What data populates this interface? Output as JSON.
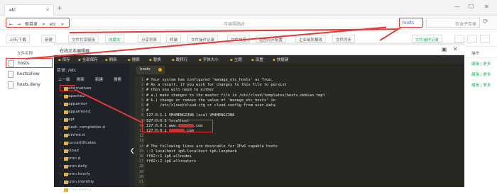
{
  "tab": {
    "title": "etc"
  },
  "window": {
    "minimize": "—",
    "maximize": "☐",
    "close": "✕"
  },
  "addressbar": {
    "back": "←",
    "forward": "→",
    "crumbs": [
      "根目录",
      ">",
      "etc",
      ">"
    ],
    "url": "",
    "url_hint": "可编辑路径",
    "search_value": "hosts",
    "search_placeholder": "包含子目录",
    "refresh": "⟳"
  },
  "toolbar": {
    "buttons": [
      "上传/下载",
      "新建",
      "文件共享链接",
      "收藏夹",
      "分享列表",
      "终端",
      "文件操作记录",
      "文件加密",
      "远程同步配置",
      "企业级防篡改",
      "文件同步"
    ],
    "right_label": "文件操作记录"
  },
  "filelist": {
    "header_name": "文件名称",
    "header_ops": "操作",
    "files": [
      {
        "name": "hosts",
        "ops": "编辑 | 更多"
      },
      {
        "name": "hostsallow",
        "ops": "编辑 | 更多"
      },
      {
        "name": "hosts.deny",
        "ops": "编辑 | 更多"
      }
    ]
  },
  "editor": {
    "title": "在线文本编辑器",
    "menu": [
      "保存",
      "全部保存",
      "刷新",
      "搜索",
      "替换",
      "跳转行",
      "字体大小",
      "主题",
      "设置",
      "快捷键"
    ],
    "dir_label": "目录: /etc",
    "side_buttons": [
      "上一级",
      "刷新",
      "新建",
      "搜索"
    ],
    "folders": [
      "alternatives",
      "apache2",
      "apparmor",
      "apparmor.d",
      "apt",
      "bash_completion.d",
      "binfmt.d",
      "ca-certificates",
      "cloud",
      "cron.d",
      "cron.daily",
      "cron.hourly",
      "cron.monthly",
      "cron.weekly"
    ],
    "open_tab": "hosts",
    "lines": [
      "# Your system has configured 'manage_etc_hosts' as True.",
      "# As a result, if you wish for changes to this file to persist",
      "# then you will need to either",
      "# a.) make changes to the master file in /etc/cloud/templates/hosts.debian.tmpl",
      "# b.) change or remove the value of 'manage_etc_hosts' in",
      "#     /etc/cloud/cloud.cfg or cloud-config from user-data",
      "#",
      "127.0.1.1 VM4MENGZ3N8.local VM4MENGZ3N8",
      "127.0.0.1 localhost",
      "127.0.0.1 www.",
      "127.0.0.1 ",
      "",
      "",
      "# The following lines are desirable for IPv6 capable hosts",
      "::1 localhost ip6-localhost ip6-loopback",
      "ff02::1 ip6-allnodes",
      "ff02::2 ip6-allrouters",
      "",
      "",
      "",
      ""
    ],
    "line_suffixes": {
      "9": ".com",
      "10": ".com"
    },
    "collapse_glyph": "❮"
  }
}
